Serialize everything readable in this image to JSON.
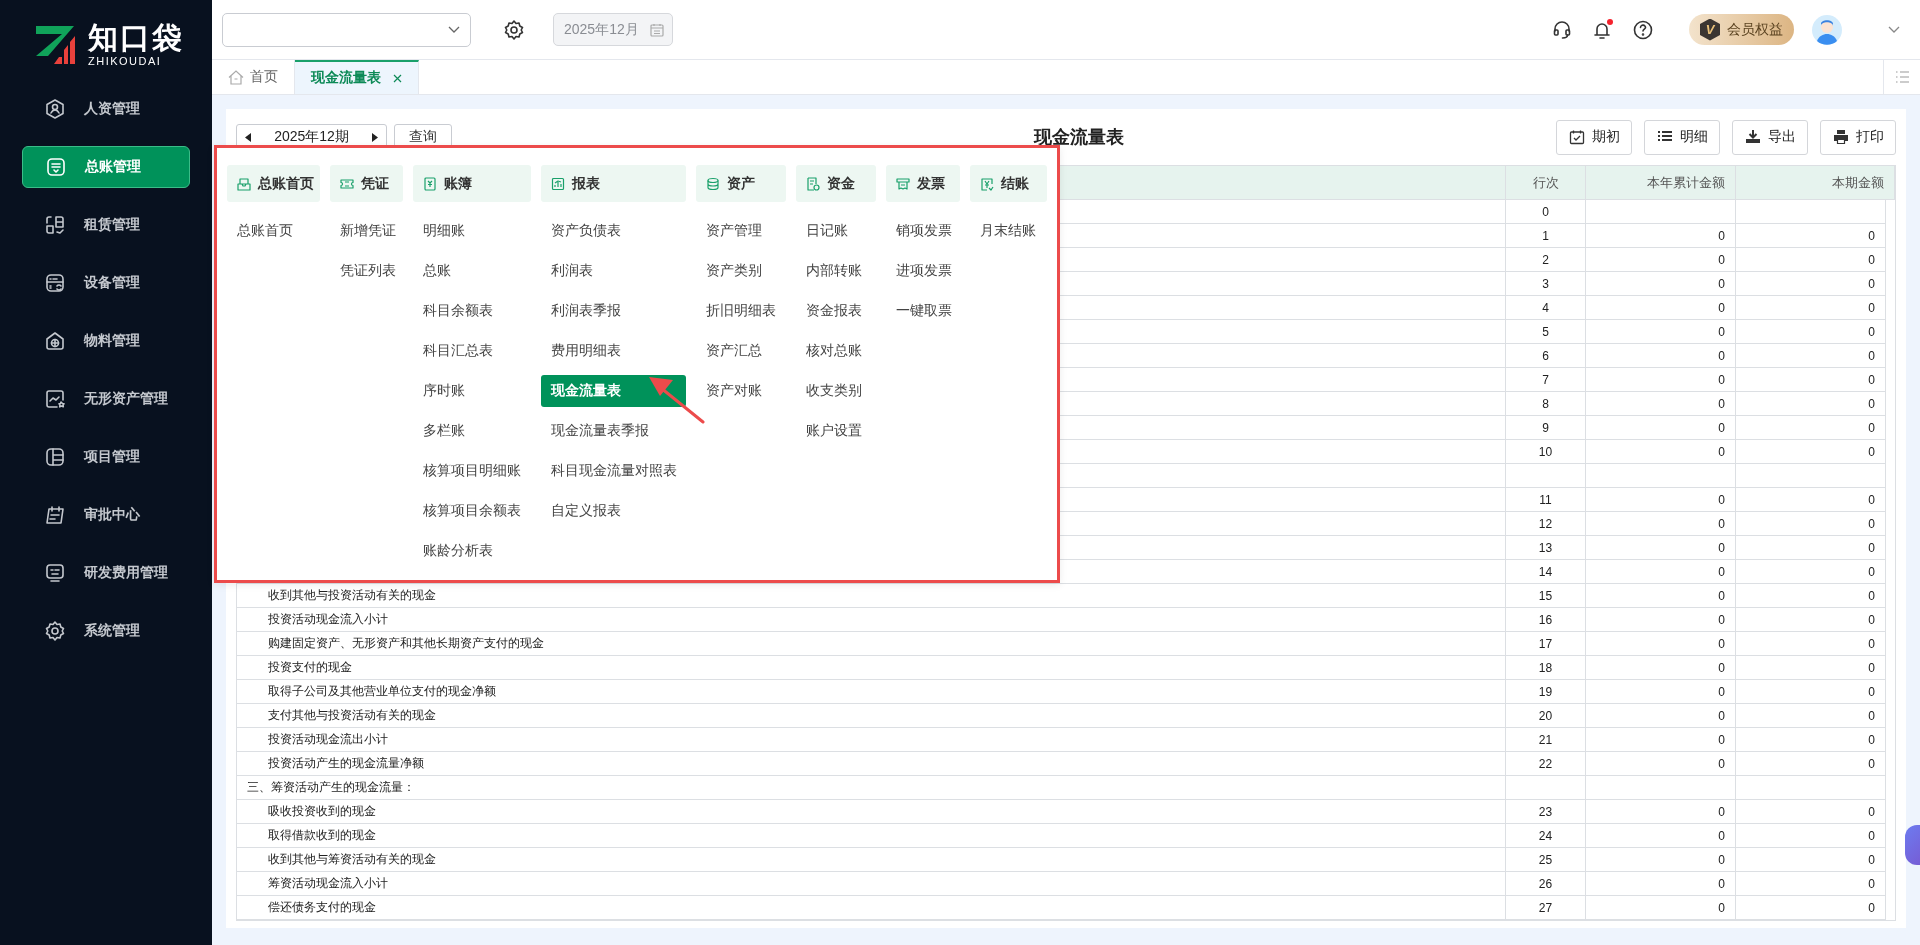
{
  "brand": {
    "name": "知口袋",
    "subtitle": "ZHIKOUDAI"
  },
  "sidebar": {
    "items": [
      {
        "label": "人资管理",
        "selected": false
      },
      {
        "label": "总账管理",
        "selected": true
      },
      {
        "label": "租赁管理",
        "selected": false
      },
      {
        "label": "设备管理",
        "selected": false
      },
      {
        "label": "物料管理",
        "selected": false
      },
      {
        "label": "无形资产管理",
        "selected": false
      },
      {
        "label": "项目管理",
        "selected": false
      },
      {
        "label": "审批中心",
        "selected": false
      },
      {
        "label": "研发费用管理",
        "selected": false
      },
      {
        "label": "系统管理",
        "selected": false
      }
    ]
  },
  "topbar": {
    "date": "2025年12月",
    "date_disabled": true,
    "notification_unread": true,
    "member_badge": "V",
    "member_label": "会员权益"
  },
  "tabs": [
    {
      "label": "首页",
      "selected": false,
      "closable": false
    },
    {
      "label": "现金流量表",
      "selected": true,
      "closable": true
    }
  ],
  "toolbar": {
    "period": "2025年12期",
    "query_button": "查询",
    "title": "现金流量表",
    "buttons": [
      "期初",
      "明细",
      "导出",
      "打印"
    ]
  },
  "table": {
    "columns": [
      "行次",
      "本年累计金额",
      "本期金额"
    ],
    "rows": [
      {
        "kind": "item",
        "line": "0"
      },
      {
        "kind": "item",
        "line": "1",
        "year": "0",
        "period": "0"
      },
      {
        "kind": "item",
        "line": "2",
        "year": "0",
        "period": "0"
      },
      {
        "kind": "item",
        "line": "3",
        "year": "0",
        "period": "0"
      },
      {
        "kind": "item",
        "line": "4",
        "year": "0",
        "period": "0"
      },
      {
        "kind": "item",
        "line": "5",
        "year": "0",
        "period": "0"
      },
      {
        "kind": "item",
        "line": "6",
        "year": "0",
        "period": "0"
      },
      {
        "kind": "item",
        "line": "7",
        "year": "0",
        "period": "0"
      },
      {
        "kind": "item",
        "line": "8",
        "year": "0",
        "period": "0"
      },
      {
        "kind": "item",
        "line": "9",
        "year": "0",
        "period": "0"
      },
      {
        "kind": "item",
        "line": "10",
        "year": "0",
        "period": "0"
      },
      {
        "kind": "section"
      },
      {
        "kind": "item",
        "line": "11",
        "year": "0",
        "period": "0"
      },
      {
        "kind": "item",
        "line": "12",
        "year": "0",
        "period": "0"
      },
      {
        "kind": "item",
        "line": "13",
        "year": "0",
        "period": "0"
      },
      {
        "kind": "item",
        "line": "14",
        "year": "0",
        "period": "0"
      },
      {
        "kind": "item",
        "name": "收到其他与投资活动有关的现金",
        "line": "15",
        "year": "0",
        "period": "0"
      },
      {
        "kind": "item",
        "name": "投资活动现金流入小计",
        "line": "16",
        "year": "0",
        "period": "0"
      },
      {
        "kind": "item",
        "name": "购建固定资产、无形资产和其他长期资产支付的现金",
        "line": "17",
        "year": "0",
        "period": "0"
      },
      {
        "kind": "item",
        "name": "投资支付的现金",
        "line": "18",
        "year": "0",
        "period": "0"
      },
      {
        "kind": "item",
        "name": "取得子公司及其他营业单位支付的现金净额",
        "line": "19",
        "year": "0",
        "period": "0"
      },
      {
        "kind": "item",
        "name": "支付其他与投资活动有关的现金",
        "line": "20",
        "year": "0",
        "period": "0"
      },
      {
        "kind": "item",
        "name": "投资活动现金流出小计",
        "line": "21",
        "year": "0",
        "period": "0"
      },
      {
        "kind": "item",
        "name": "投资活动产生的现金流量净额",
        "line": "22",
        "year": "0",
        "period": "0"
      },
      {
        "kind": "section",
        "name": "三、筹资活动产生的现金流量："
      },
      {
        "kind": "item",
        "name": "吸收投资收到的现金",
        "line": "23",
        "year": "0",
        "period": "0"
      },
      {
        "kind": "item",
        "name": "取得借款收到的现金",
        "line": "24",
        "year": "0",
        "period": "0"
      },
      {
        "kind": "item",
        "name": "收到其他与筹资活动有关的现金",
        "line": "25",
        "year": "0",
        "period": "0"
      },
      {
        "kind": "item",
        "name": "筹资活动现金流入小计",
        "line": "26",
        "year": "0",
        "period": "0"
      },
      {
        "kind": "item",
        "name": "偿还债务支付的现金",
        "line": "27",
        "year": "0",
        "period": "0"
      }
    ]
  },
  "menu": {
    "groups": [
      {
        "title": "总账首页",
        "items": [
          {
            "label": "总账首页",
            "selected": false
          }
        ]
      },
      {
        "title": "凭证",
        "items": [
          {
            "label": "新增凭证",
            "selected": false
          },
          {
            "label": "凭证列表",
            "selected": false
          }
        ]
      },
      {
        "title": "账簿",
        "items": [
          {
            "label": "明细账",
            "selected": false
          },
          {
            "label": "总账",
            "selected": false
          },
          {
            "label": "科目余额表",
            "selected": false
          },
          {
            "label": "科目汇总表",
            "selected": false
          },
          {
            "label": "序时账",
            "selected": false
          },
          {
            "label": "多栏账",
            "selected": false
          },
          {
            "label": "核算项目明细账",
            "selected": false
          },
          {
            "label": "核算项目余额表",
            "selected": false
          },
          {
            "label": "账龄分析表",
            "selected": false
          }
        ]
      },
      {
        "title": "报表",
        "items": [
          {
            "label": "资产负债表",
            "selected": false
          },
          {
            "label": "利润表",
            "selected": false
          },
          {
            "label": "利润表季报",
            "selected": false
          },
          {
            "label": "费用明细表",
            "selected": false
          },
          {
            "label": "现金流量表",
            "selected": true
          },
          {
            "label": "现金流量表季报",
            "selected": false
          },
          {
            "label": "科目现金流量对照表",
            "selected": false
          },
          {
            "label": "自定义报表",
            "selected": false
          }
        ]
      },
      {
        "title": "资产",
        "items": [
          {
            "label": "资产管理",
            "selected": false
          },
          {
            "label": "资产类别",
            "selected": false
          },
          {
            "label": "折旧明细表",
            "selected": false
          },
          {
            "label": "资产汇总",
            "selected": false
          },
          {
            "label": "资产对账",
            "selected": false
          }
        ]
      },
      {
        "title": "资金",
        "items": [
          {
            "label": "日记账",
            "selected": false
          },
          {
            "label": "内部转账",
            "selected": false
          },
          {
            "label": "资金报表",
            "selected": false
          },
          {
            "label": "核对总账",
            "selected": false
          },
          {
            "label": "收支类别",
            "selected": false
          },
          {
            "label": "账户设置",
            "selected": false
          }
        ]
      },
      {
        "title": "发票",
        "items": [
          {
            "label": "销项发票",
            "selected": false
          },
          {
            "label": "进项发票",
            "selected": false
          },
          {
            "label": "一键取票",
            "selected": false
          }
        ]
      },
      {
        "title": "结账",
        "items": [
          {
            "label": "月末结账",
            "selected": false
          }
        ]
      }
    ]
  }
}
